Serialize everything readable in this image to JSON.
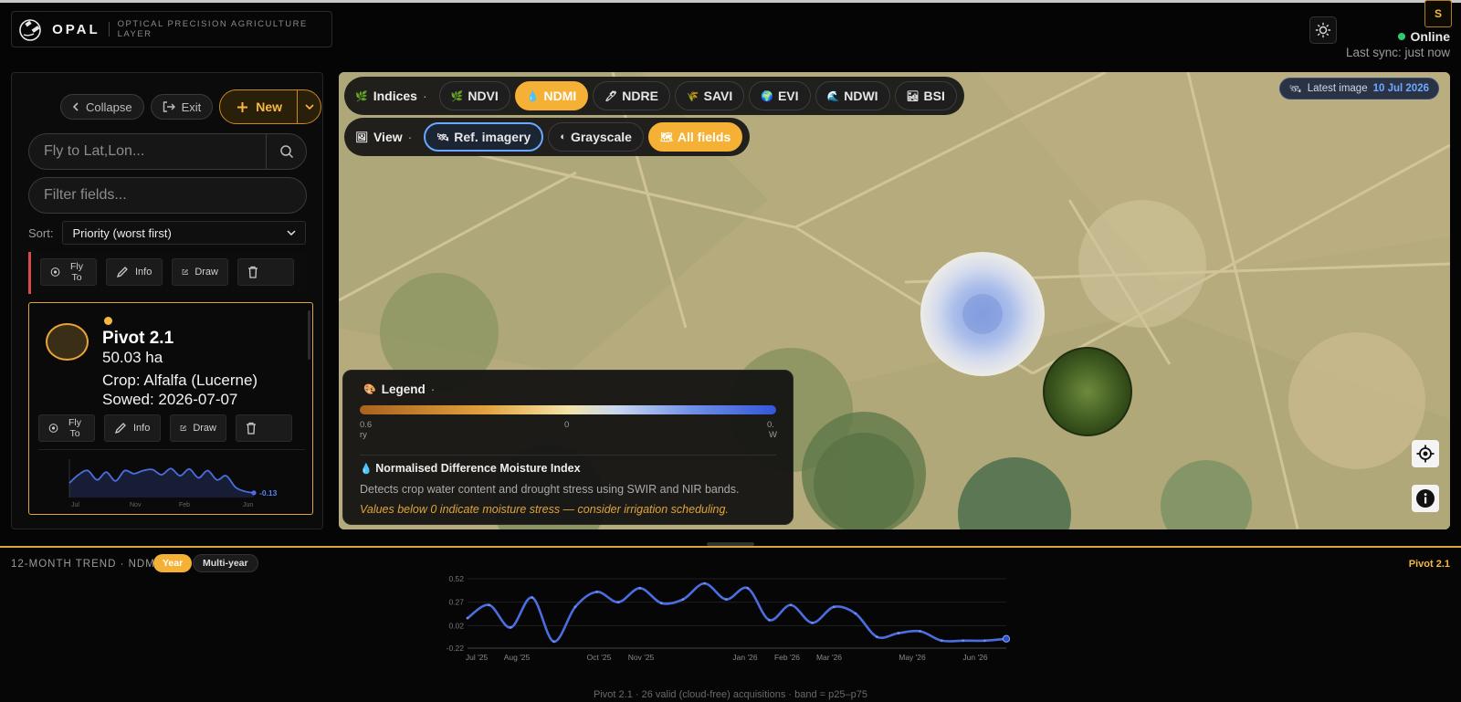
{
  "header": {
    "brand_name": "OPAL",
    "brand_tagline": "OPTICAL PRECISION AGRICULTURE LAYER",
    "user_initial": "S",
    "status_online": "Online",
    "last_sync": "Last sync: just now"
  },
  "sidebar": {
    "collapse_label": "Collapse",
    "exit_label": "Exit",
    "new_label": "New",
    "search_placeholder": "Fly to Lat,Lon...",
    "filter_placeholder": "Filter fields...",
    "sort_label": "Sort:",
    "sort_value": "Priority (worst first)",
    "actions": {
      "fly_to": "Fly To",
      "info": "Info",
      "draw": "Draw"
    },
    "selected_field": {
      "name": "Pivot 2.1",
      "area": "50.03 ha",
      "crop": "Crop: Alfalfa (Lucerne)",
      "sowed": "Sowed: 2026-07-07",
      "status_color": "#f5b942",
      "sparkline": {
        "values": [
          0.06,
          0.22,
          0.3,
          0.12,
          0.27,
          0.1,
          0.3,
          0.24,
          0.3,
          0.32,
          0.22,
          0.34,
          0.2,
          0.33,
          0.16,
          0.3,
          0.12,
          0.2,
          -0.02,
          -0.1,
          -0.13
        ],
        "last_value_label": "-0.13",
        "tick_labels": [
          "Jul",
          "Nov",
          "Feb",
          "Jun"
        ]
      }
    }
  },
  "map": {
    "indices_label": "Indices",
    "indices": [
      {
        "label": "NDVI",
        "icon": "leaf-icon",
        "active": false
      },
      {
        "label": "NDMI",
        "icon": "droplet-icon",
        "active": true
      },
      {
        "label": "NDRE",
        "icon": "pencil-leaf-icon",
        "active": false
      },
      {
        "label": "SAVI",
        "icon": "soil-plant-icon",
        "active": false
      },
      {
        "label": "EVI",
        "icon": "globe-icon",
        "active": false
      },
      {
        "label": "NDWI",
        "icon": "water-wave-icon",
        "active": false
      },
      {
        "label": "BSI",
        "icon": "bare-soil-icon",
        "active": false
      }
    ],
    "view_label": "View",
    "view_options": [
      {
        "label": "Ref. imagery",
        "state": "outlined"
      },
      {
        "label": "Grayscale",
        "state": "normal"
      },
      {
        "label": "All fields",
        "state": "active"
      }
    ],
    "latest_image_label": "Latest image",
    "latest_image_date": "10 Jul 2026",
    "legend": {
      "header": "Legend",
      "tick_left": "0.6",
      "tick_left_sub": "ry",
      "tick_mid": "0",
      "tick_right": "0.",
      "tick_right_sub": "W",
      "index_title": "Normalised Difference Moisture Index",
      "description": "Detects crop water content and drought stress using SWIR and NIR bands.",
      "warning": "Values below 0 indicate moisture stress — consider irrigation scheduling.",
      "gradient_colors": [
        "#a8621e",
        "#e2a13d",
        "#f3e4a8",
        "#c9d6ef",
        "#6f8fe6",
        "#3456d9"
      ]
    }
  },
  "trend": {
    "title": "12-MONTH TREND · NDMI",
    "year_label": "Year",
    "multi_year_label": "Multi-year",
    "field_name": "Pivot 2.1",
    "footer": "Pivot 2.1 · 26 valid (cloud-free) acquisitions · band = p25–p75",
    "line_color": "#4a6ee0",
    "chart_data": {
      "type": "line",
      "y_ticks": [
        "0.52",
        "0.27",
        "0.02",
        "-0.22"
      ],
      "ylim": [
        -0.22,
        0.52
      ],
      "x_labels": [
        "Jul '25",
        "Aug '25",
        "Oct '25",
        "Nov '25",
        "Jan '26",
        "Feb '26",
        "Mar '26",
        "May '26",
        "Jun '26"
      ],
      "series": [
        {
          "values": [
            0.1,
            0.24,
            0.0,
            0.32,
            -0.15,
            0.22,
            0.38,
            0.27,
            0.42,
            0.26,
            0.3,
            0.47,
            0.3,
            0.42,
            0.08,
            0.24,
            0.05,
            0.22,
            0.15,
            -0.1,
            -0.06,
            -0.04,
            -0.14,
            -0.14,
            -0.14,
            -0.12
          ]
        }
      ]
    }
  }
}
